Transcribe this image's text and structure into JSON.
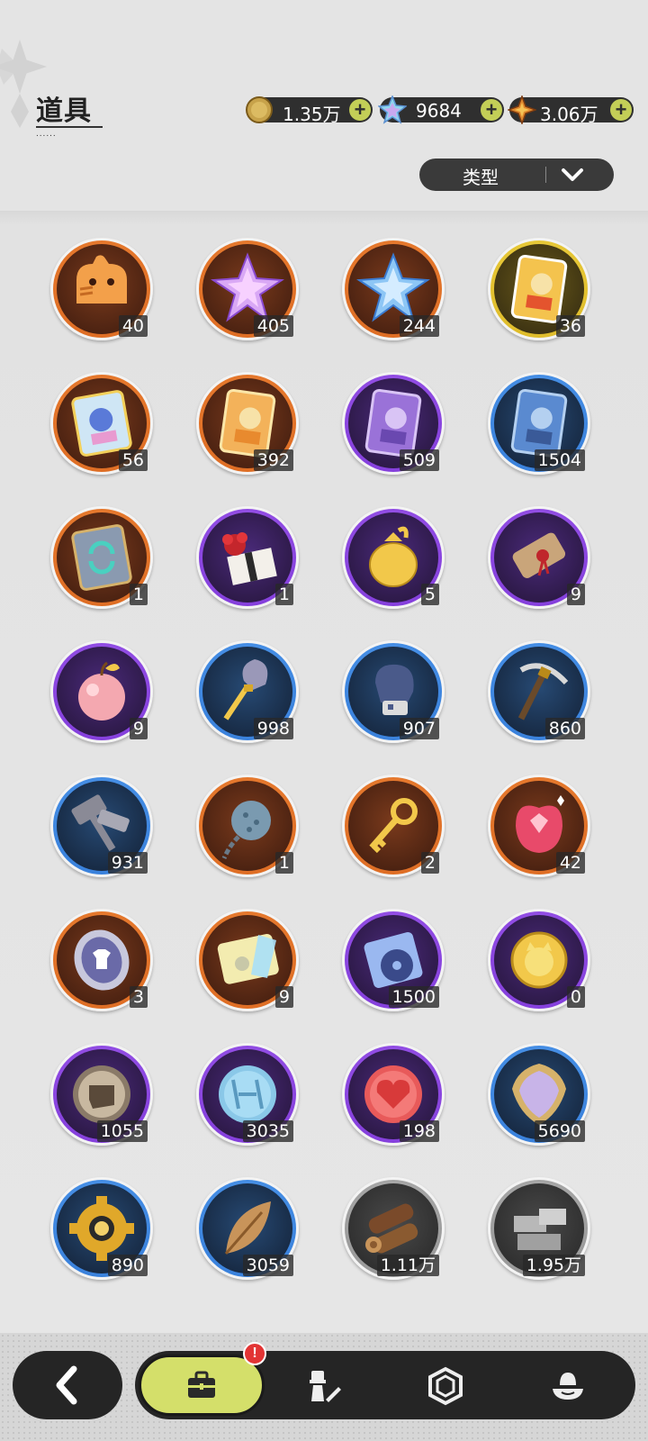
{
  "header": {
    "title": "道具"
  },
  "currencies": [
    {
      "icon": "gold-coin-icon",
      "value": "1.35万"
    },
    {
      "icon": "crystal-gem-icon",
      "value": "9684"
    },
    {
      "icon": "star-shard-icon",
      "value": "3.06万"
    }
  ],
  "filter": {
    "label": "类型"
  },
  "items": [
    {
      "icon": "puzzle-piece-cat-icon",
      "count": "40",
      "rarity": "orange"
    },
    {
      "icon": "pink-crystal-icon",
      "count": "405",
      "rarity": "orange"
    },
    {
      "icon": "blue-crystal-icon",
      "count": "244",
      "rarity": "orange"
    },
    {
      "icon": "gold-character-card-icon",
      "count": "36",
      "rarity": "gold"
    },
    {
      "icon": "holo-character-card-icon",
      "count": "56",
      "rarity": "orange"
    },
    {
      "icon": "orange-character-card-icon",
      "count": "392",
      "rarity": "orange"
    },
    {
      "icon": "purple-character-card-icon",
      "count": "509",
      "rarity": "purple"
    },
    {
      "icon": "blue-character-card-icon",
      "count": "1504",
      "rarity": "blue"
    },
    {
      "icon": "reset-card-icon",
      "count": "1",
      "rarity": "orange"
    },
    {
      "icon": "gift-box-flower-icon",
      "count": "1",
      "rarity": "purple"
    },
    {
      "icon": "gold-pouch-icon",
      "count": "5",
      "rarity": "purple"
    },
    {
      "icon": "scroll-icon",
      "count": "9",
      "rarity": "purple"
    },
    {
      "icon": "pink-apple-icon",
      "count": "9",
      "rarity": "purple"
    },
    {
      "icon": "shovel-icon",
      "count": "998",
      "rarity": "blue"
    },
    {
      "icon": "boxing-glove-icon",
      "count": "907",
      "rarity": "blue"
    },
    {
      "icon": "pickaxe-icon",
      "count": "860",
      "rarity": "blue"
    },
    {
      "icon": "hammer-icon",
      "count": "931",
      "rarity": "blue"
    },
    {
      "icon": "spiked-mine-icon",
      "count": "1",
      "rarity": "orange"
    },
    {
      "icon": "golden-key-icon",
      "count": "2",
      "rarity": "orange"
    },
    {
      "icon": "ruby-apple-icon",
      "count": "42",
      "rarity": "orange"
    },
    {
      "icon": "outfit-coin-icon",
      "count": "3",
      "rarity": "orange"
    },
    {
      "icon": "rainbow-ticket-icon",
      "count": "9",
      "rarity": "orange"
    },
    {
      "icon": "music-record-icon",
      "count": "1500",
      "rarity": "purple"
    },
    {
      "icon": "cat-gold-coin-icon",
      "count": "0",
      "rarity": "purple"
    },
    {
      "icon": "fist-token-icon",
      "count": "1055",
      "rarity": "purple"
    },
    {
      "icon": "rune-stone-icon",
      "count": "3035",
      "rarity": "purple"
    },
    {
      "icon": "heart-token-icon",
      "count": "198",
      "rarity": "purple"
    },
    {
      "icon": "scale-shield-icon",
      "count": "5690",
      "rarity": "blue"
    },
    {
      "icon": "gear-icon",
      "count": "890",
      "rarity": "blue"
    },
    {
      "icon": "leaf-icon",
      "count": "3059",
      "rarity": "blue"
    },
    {
      "icon": "wood-logs-icon",
      "count": "1.11万",
      "rarity": "gray"
    },
    {
      "icon": "stone-bricks-icon",
      "count": "1.95万",
      "rarity": "gray"
    }
  ],
  "nav": {
    "badge": "!",
    "tabs": [
      {
        "icon": "bag-icon",
        "active": true
      },
      {
        "icon": "character-equipment-icon",
        "active": false
      },
      {
        "icon": "hexagon-icon",
        "active": false
      },
      {
        "icon": "dessert-icon",
        "active": false
      }
    ],
    "back_icon": "back-arrow-icon"
  }
}
